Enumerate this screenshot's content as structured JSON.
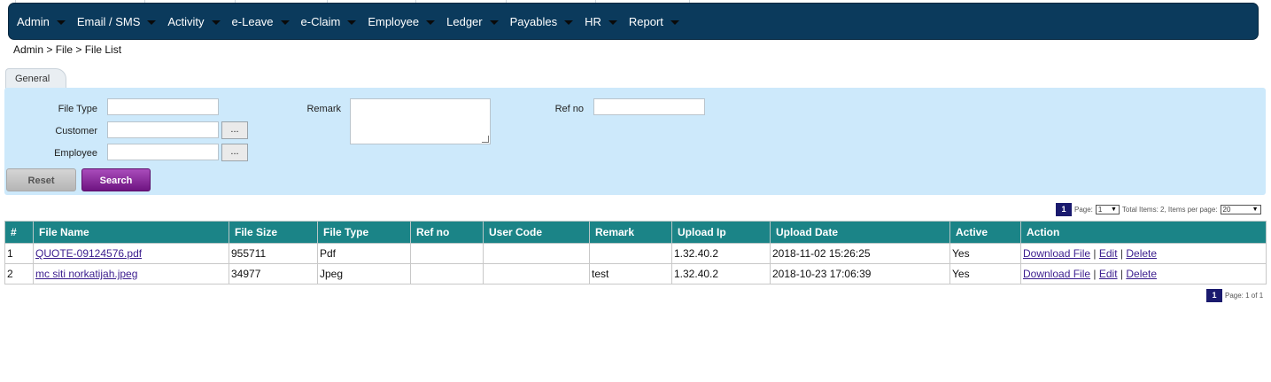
{
  "nav": {
    "items": [
      "Admin",
      "Email / SMS",
      "Activity",
      "e-Leave",
      "e-Claim",
      "Employee",
      "Ledger",
      "Payables",
      "HR",
      "Report"
    ]
  },
  "breadcrumb": "Admin > File > File List",
  "tab": {
    "label": "General"
  },
  "form": {
    "file_type_label": "File Type",
    "customer_label": "Customer",
    "employee_label": "Employee",
    "remark_label": "Remark",
    "ref_no_label": "Ref no",
    "lookup_button": "...",
    "file_type_value": "",
    "customer_value": "",
    "employee_value": "",
    "ref_no_value": "",
    "remark_value": ""
  },
  "buttons": {
    "reset": "Reset",
    "search": "Search"
  },
  "pager_top": {
    "current_page": "1",
    "page_label": "Page:",
    "page_select": "1",
    "summary": "Total Items: 2, Items per page:",
    "per_page": "20"
  },
  "table": {
    "headers": [
      "#",
      "File Name",
      "File Size",
      "File Type",
      "Ref no",
      "User Code",
      "Remark",
      "Upload Ip",
      "Upload Date",
      "Active",
      "Action"
    ],
    "rows": [
      {
        "num": "1",
        "file_name": "QUOTE-09124576.pdf",
        "file_size": "955711",
        "file_type": "Pdf",
        "ref_no": "",
        "user_code": "",
        "remark": "",
        "upload_ip": "1.32.40.2",
        "upload_date": "2018-11-02 15:26:25",
        "active": "Yes"
      },
      {
        "num": "2",
        "file_name": "mc siti norkatijah.jpeg",
        "file_size": "34977",
        "file_type": "Jpeg",
        "ref_no": "",
        "user_code": "",
        "remark": "test",
        "upload_ip": "1.32.40.2",
        "upload_date": "2018-10-23 17:06:39",
        "active": "Yes"
      }
    ],
    "actions": {
      "download": "Download File",
      "edit": "Edit",
      "delete": "Delete",
      "separator": "|"
    }
  },
  "pager_bottom": {
    "current_page": "1",
    "summary": "Page: 1 of 1"
  },
  "colors": {
    "navbar": "#0b3a5c",
    "panel": "#cde9fb",
    "table_header": "#1b8487",
    "search_button": "#7a1a8d",
    "pager": "#1a1a6e"
  }
}
